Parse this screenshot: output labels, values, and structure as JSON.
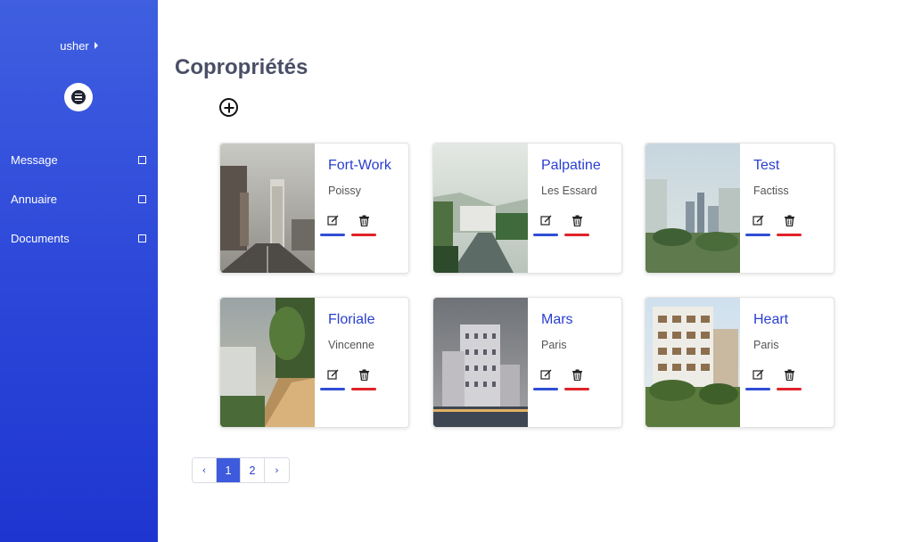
{
  "sidebar": {
    "user": "usher",
    "nav": [
      {
        "label": "Message"
      },
      {
        "label": "Annuaire"
      },
      {
        "label": "Documents"
      }
    ]
  },
  "main": {
    "title": "Copropriétés",
    "cards": [
      {
        "name": "Fort-Work",
        "city": "Poissy"
      },
      {
        "name": "Palpatine",
        "city": "Les Essard"
      },
      {
        "name": "Test",
        "city": "Factiss"
      },
      {
        "name": "Floriale",
        "city": "Vincenne"
      },
      {
        "name": "Mars",
        "city": "Paris"
      },
      {
        "name": "Heart",
        "city": "Paris"
      }
    ]
  },
  "pagination": {
    "prev": "‹",
    "pages": [
      "1",
      "2"
    ],
    "current": "1",
    "next": "›"
  },
  "colors": {
    "sidebar_top": "#3f5fe0",
    "sidebar_bottom": "#1e36cf",
    "accent": "#2a3fcf",
    "edit_bar": "#2f4ed6",
    "delete_bar": "#e0222a"
  },
  "icons": {
    "menu": "list-icon",
    "add": "plus-circle-icon",
    "edit": "edit-icon",
    "delete": "trash-icon"
  }
}
